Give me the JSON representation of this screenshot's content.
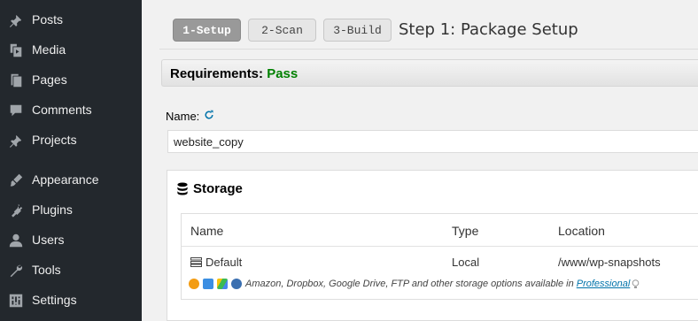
{
  "sidebar": {
    "items": [
      {
        "label": "Posts",
        "icon": "pin-icon"
      },
      {
        "label": "Media",
        "icon": "media-icon"
      },
      {
        "label": "Pages",
        "icon": "pages-icon"
      },
      {
        "label": "Comments",
        "icon": "comment-icon"
      },
      {
        "label": "Projects",
        "icon": "pin-icon"
      },
      {
        "label": "Appearance",
        "icon": "brush-icon"
      },
      {
        "label": "Plugins",
        "icon": "plug-icon"
      },
      {
        "label": "Users",
        "icon": "user-icon"
      },
      {
        "label": "Tools",
        "icon": "wrench-icon"
      },
      {
        "label": "Settings",
        "icon": "settings-icon"
      }
    ]
  },
  "steps": {
    "tabs": [
      {
        "label": "1-Setup",
        "active": true
      },
      {
        "label": "2-Scan",
        "active": false
      },
      {
        "label": "3-Build",
        "active": false
      }
    ],
    "title": "Step 1: Package Setup"
  },
  "requirements": {
    "label": "Requirements:",
    "status": "Pass",
    "status_color": "#008000"
  },
  "name_field": {
    "label": "Name:",
    "value": "website_copy"
  },
  "storage": {
    "title": "Storage",
    "columns": [
      "Name",
      "Type",
      "Location"
    ],
    "rows": [
      {
        "name": "Default",
        "type": "Local",
        "location": "/www/wp-snapshots"
      }
    ],
    "promo_text": "Amazon, Dropbox, Google Drive, FTP and other storage options available in",
    "promo_link": "Professional"
  },
  "colors": {
    "sidebar_bg": "#23282d",
    "page_bg": "#f1f1f1",
    "link": "#0073aa"
  }
}
